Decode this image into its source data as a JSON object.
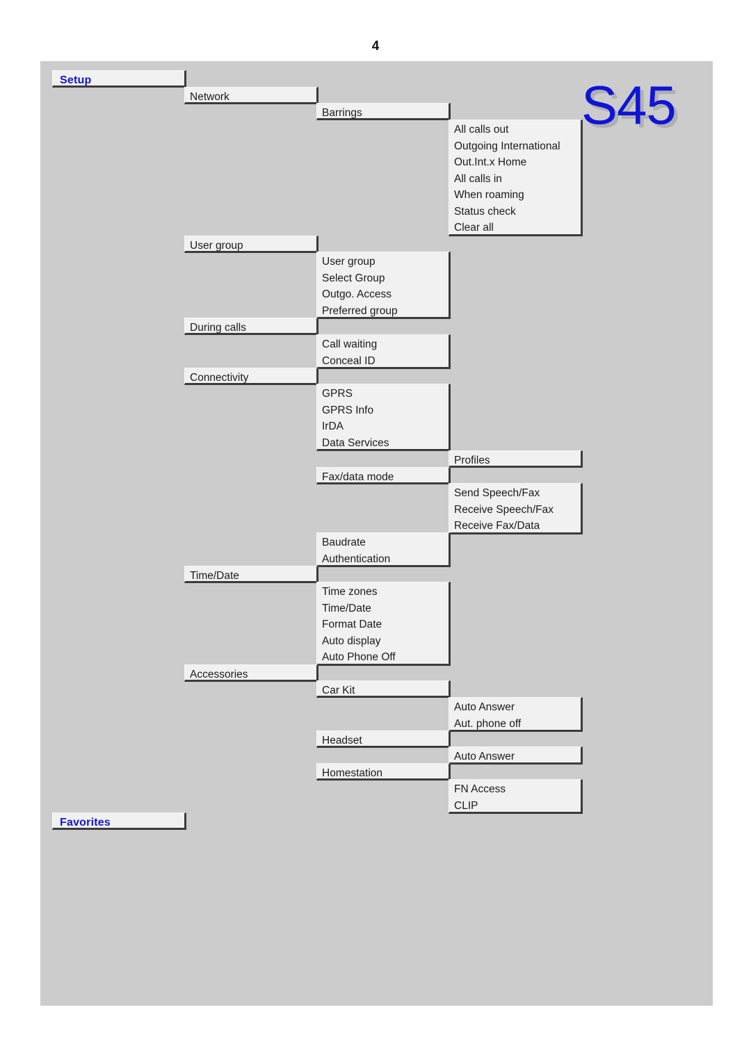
{
  "page": {
    "number": "4",
    "logo": "S45",
    "background_color": "#cccccc",
    "box_fill_color": "#f1f1f1",
    "title_color": "#0f14d6"
  },
  "menu": {
    "title_setup": "Setup",
    "title_favorites": "Favorites",
    "boxes": {
      "network": [
        "Network"
      ],
      "barrings": [
        "Barrings"
      ],
      "barrings_items": [
        "All calls out",
        "Outgoing International",
        "Out.Int.x Home",
        "All calls in",
        "When roaming",
        "Status check",
        "Clear all"
      ],
      "user_group": [
        "User group"
      ],
      "user_group_items": [
        "User group",
        "Select Group",
        "Outgo. Access",
        "Preferred group"
      ],
      "during_calls": [
        "During calls"
      ],
      "during_calls_items": [
        "Call waiting",
        "Conceal ID"
      ],
      "connectivity": [
        "Connectivity"
      ],
      "connectivity_items": [
        "GPRS",
        "GPRS Info",
        "IrDA",
        "Data Services"
      ],
      "profiles": [
        "Profiles"
      ],
      "fax_data_mode": [
        "Fax/data mode"
      ],
      "fax_data_mode_items": [
        "Send Speech/Fax",
        "Receive Speech/Fax",
        "Receive Fax/Data"
      ],
      "baudrate_items": [
        "Baudrate",
        "Authentication"
      ],
      "time_date": [
        "Time/Date"
      ],
      "time_date_items": [
        "Time zones",
        "Time/Date",
        "Format Date",
        "Auto display",
        "Auto Phone Off"
      ],
      "accessories": [
        "Accessories"
      ],
      "car_kit": [
        "Car Kit"
      ],
      "car_kit_items": [
        "Auto Answer",
        "Aut. phone off"
      ],
      "headset": [
        "Headset"
      ],
      "headset_items": [
        "Auto Answer"
      ],
      "homestation": [
        "Homestation"
      ],
      "homestation_items": [
        "FN Access",
        "CLIP"
      ]
    }
  }
}
